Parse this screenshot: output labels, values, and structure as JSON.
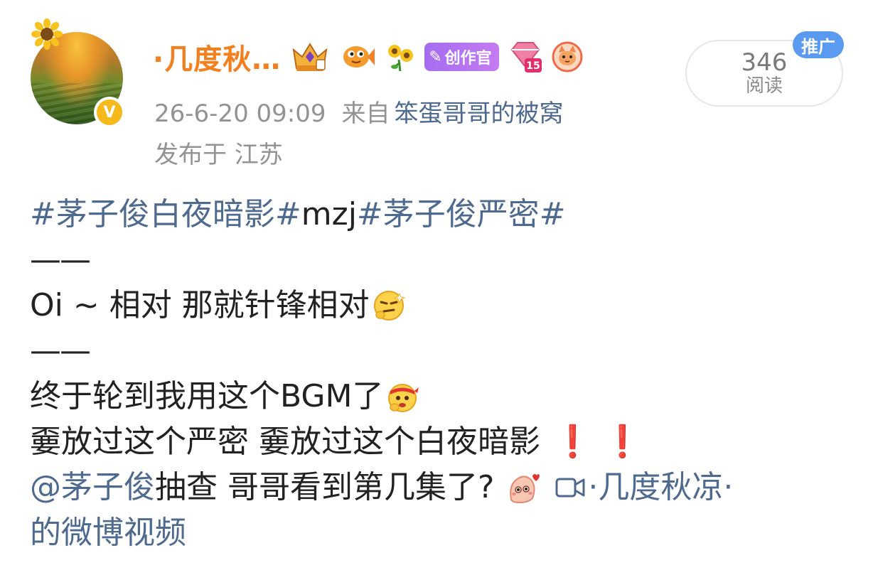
{
  "post": {
    "username": "·几度秋…",
    "creator_badge": "创作官",
    "level_badge": "15",
    "timestamp": "26-6-20 09:09",
    "from_label": "来自",
    "source": "笨蛋哥哥的被窝",
    "location": "发布于 江苏",
    "reads_count": "346",
    "reads_label": "阅读",
    "promo_badge": "推广"
  },
  "content": {
    "line1_tag1": "#茅子俊白夜暗影#",
    "line1_text": " mzj",
    "line1_tag2": "#茅子俊严密#",
    "separator": "——",
    "line3_text": "Oi ~ 相对  那就针锋相对",
    "line5_text": "终于轮到我用这个BGM了",
    "line6_text": "嫑放过这个严密 嫑放过这个白夜暗影",
    "line6_excl": "❗ ❗",
    "line7_mention": "@茅子俊",
    "line7_text": " 抽查  哥哥看到第几集了?",
    "line7_video_link": "·几度秋凉·",
    "line8_video_link": "的微博视频"
  },
  "icons": {
    "verified": "verified-v-icon",
    "crown": "crown-badge-icon",
    "fish": "fish-badge-icon",
    "sunflower": "sunflower-badge-icon",
    "cat": "cat-badge-icon",
    "video": "video-camera-icon"
  },
  "colors": {
    "username": "#f2801f",
    "link": "#4f6a8f",
    "meta": "#939393",
    "promo": "#5a9af0",
    "creator": "#b070f0"
  }
}
